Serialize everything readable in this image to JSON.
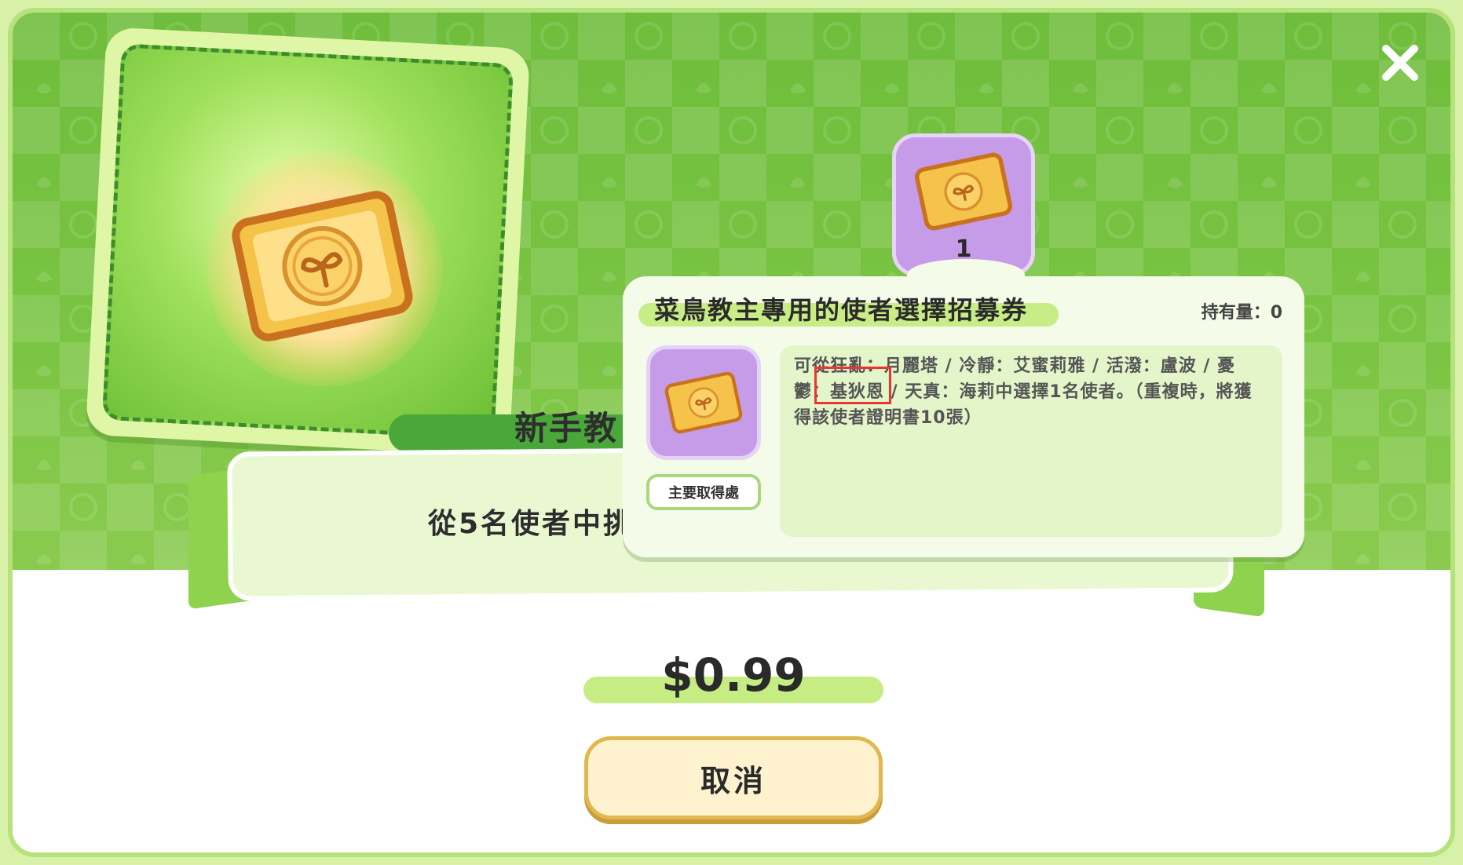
{
  "dialog": {
    "close_label": "",
    "pack_title_partial": "新手教",
    "pack_desc_partial": "從5名使者中挑",
    "price": "$0.99",
    "cancel_label": "取消"
  },
  "item": {
    "count": "1",
    "name": "菜鳥教主專用的使者選擇招募券",
    "owned": "持有量：0",
    "source_label": "主要取得處",
    "description": "可從狂亂：月麗塔 / 冷靜：艾蜜莉雅 / 活潑：盧波 / 憂鬱：基狄恩 / 天真：海莉中選擇1名使者。（重複時，將獲得該使者證明書10張）"
  },
  "icons": {
    "close": "close-icon",
    "ticket": "sprout-ticket-icon"
  },
  "colors": {
    "accent_green": "#79c442",
    "ticket_gold": "#f5c24a",
    "tooltip_purple": "#c69be8"
  }
}
